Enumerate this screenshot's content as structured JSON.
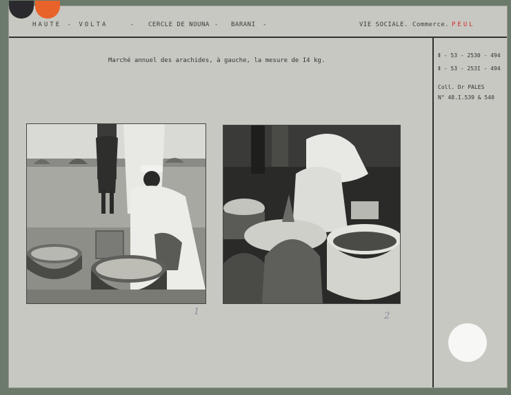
{
  "header": {
    "region": "HAUTE - VOLTA",
    "sep1": "-",
    "cercle": "CERCLE DE NOUNA",
    "sep2": "-",
    "place": "BARANI",
    "sep3": "-",
    "category": "VIE SOCIALE. Commerce.",
    "people": "PEUL"
  },
  "caption": "Marché annuel des arachides, à gauche, la mesure de I4 kg.",
  "references": {
    "ref1": "Ⅱ - 53 - 2530 - 494",
    "ref2": "Ⅱ - 53 - 253I - 494",
    "collection": "Coll. Dr PALES",
    "number": "N° 48.I.539 & 540"
  },
  "photos": [
    {
      "label": "1"
    },
    {
      "label": "2"
    }
  ],
  "colors": {
    "card": "#c8c8c2",
    "accent_orange": "#e8632a",
    "accent_red": "#d02a2a"
  }
}
